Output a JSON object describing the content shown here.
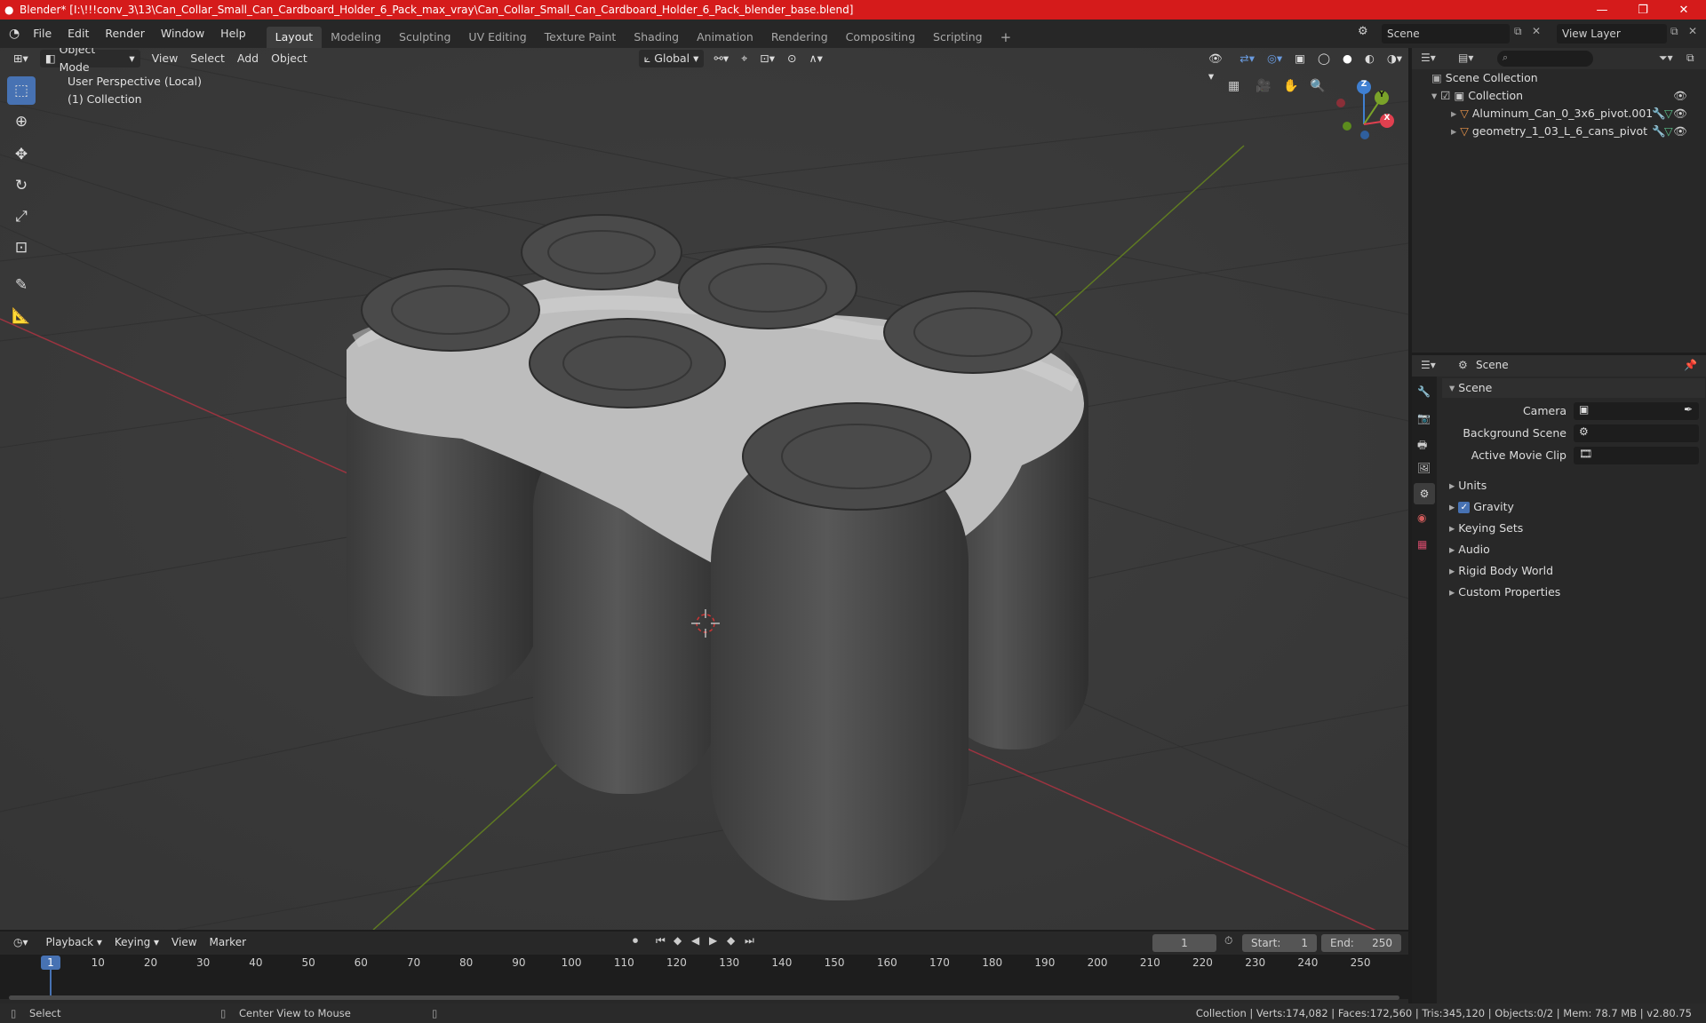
{
  "app": {
    "title": "Blender* [I:\\!!!conv_3\\13\\Can_Collar_Small_Can_Cardboard_Holder_6_Pack_max_vray\\Can_Collar_Small_Can_Cardboard_Holder_6_Pack_blender_base.blend]"
  },
  "menu": [
    "File",
    "Edit",
    "Render",
    "Window",
    "Help"
  ],
  "workspaces": [
    "Layout",
    "Modeling",
    "Sculpting",
    "UV Editing",
    "Texture Paint",
    "Shading",
    "Animation",
    "Rendering",
    "Compositing",
    "Scripting"
  ],
  "scene_field": "Scene",
  "view_layer_field": "View Layer",
  "viewport": {
    "mode": "Object Mode",
    "menus": [
      "View",
      "Select",
      "Add",
      "Object"
    ],
    "orientation": "Global",
    "perspective_label": "User Perspective (Local)",
    "collection_label": "(1) Collection",
    "gizmo_axes": {
      "x": "X",
      "y": "Y",
      "z": "Z"
    }
  },
  "outliner": {
    "root": "Scene Collection",
    "collection": "Collection",
    "objects": [
      "Aluminum_Can_0_3x6_pivot.001",
      "geometry_1_03_L_6_cans_pivot"
    ]
  },
  "properties": {
    "header": "Scene",
    "panel_title": "Scene",
    "fields": [
      {
        "label": "Camera",
        "value": ""
      },
      {
        "label": "Background Scene",
        "value": ""
      },
      {
        "label": "Active Movie Clip",
        "value": ""
      }
    ],
    "sections": [
      "Units",
      "Gravity",
      "Keying Sets",
      "Audio",
      "Rigid Body World",
      "Custom Properties"
    ],
    "gravity_checked": true
  },
  "timeline": {
    "menus": [
      "Playback",
      "Keying",
      "View",
      "Marker"
    ],
    "current_frame": "1",
    "start_label": "Start:",
    "start": "1",
    "end_label": "End:",
    "end": "250",
    "ticks": [
      "1",
      "10",
      "20",
      "30",
      "40",
      "50",
      "60",
      "70",
      "80",
      "90",
      "100",
      "110",
      "120",
      "130",
      "140",
      "150",
      "160",
      "170",
      "180",
      "190",
      "200",
      "210",
      "220",
      "230",
      "240",
      "250"
    ]
  },
  "status": {
    "select": "Select",
    "center": "Center View to Mouse",
    "stats": "Collection | Verts:174,082 | Faces:172,560 | Tris:345,120 | Objects:0/2 | Mem: 78.7 MB | v2.80.75"
  },
  "colors": {
    "title_red": "#d51b1b",
    "accent_blue": "#4772b3",
    "axis_x": "#e0404f",
    "axis_y": "#7aa329",
    "axis_z": "#3f7fd1"
  }
}
